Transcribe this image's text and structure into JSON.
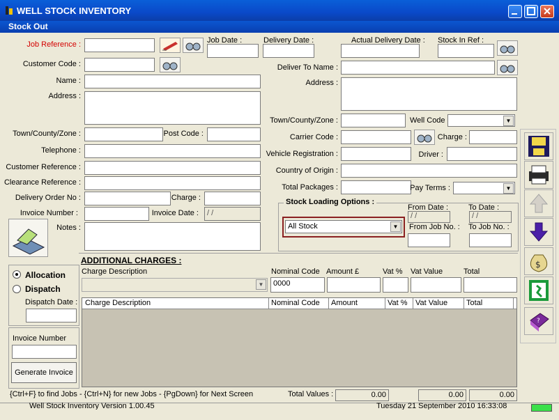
{
  "window": {
    "title": "WELL STOCK INVENTORY",
    "subtitle": "Stock Out"
  },
  "left": {
    "job_reference": "Job Reference :",
    "customer_code": "Customer Code :",
    "name": "Name :",
    "address": "Address :",
    "town": "Town/County/Zone :",
    "post_code": "Post Code :",
    "telephone": "Telephone :",
    "customer_reference": "Customer Reference :",
    "clearance_reference": "Clearance Reference :",
    "delivery_order_no": "Delivery Order No :",
    "charge": "Charge :",
    "invoice_number": "Invoice Number :",
    "invoice_date": "Invoice Date :",
    "invoice_date_value": "/ /",
    "notes": "Notes :"
  },
  "top": {
    "job_date": "Job Date :",
    "delivery_date": "Delivery Date :",
    "actual_delivery_date": "Actual Delivery Date :",
    "stock_in_ref": "Stock In Ref :"
  },
  "right": {
    "deliver_to_name": "Deliver To Name :",
    "address": "Address :",
    "town": "Town/County/Zone :",
    "well_code": "Well Code",
    "carrier_code": "Carrier Code :",
    "charge": "Charge :",
    "vehicle_registration": "Vehicle Registration :",
    "driver": "Driver :",
    "country_of_origin": "Country of Origin :",
    "total_packages": "Total Packages :",
    "pay_terms": "Pay Terms :"
  },
  "stock_loading": {
    "title": "Stock Loading Options :",
    "selected": "All Stock",
    "from_date": "From  Date :",
    "to_date": "To  Date :",
    "from_date_value": "/ /",
    "to_date_value": "/ /",
    "from_job_no": "From  Job No. :",
    "to_job_no": "To Job No. :"
  },
  "mode": {
    "allocation": "Allocation",
    "dispatch": "Dispatch",
    "dispatch_date": "Dispatch Date :",
    "invoice_number": "Invoice Number",
    "generate_invoice": "Generate Invoice"
  },
  "charges": {
    "title": "ADDITIONAL CHARGES :",
    "charge_description": "Charge Description",
    "nominal_code": "Nominal Code",
    "amount": "Amount £",
    "vat_pct": "Vat %",
    "vat_value": "Vat Value",
    "total": "Total",
    "nominal_value": "0000",
    "grid_headers": [
      "Charge Description",
      "Nominal Code",
      "Amount",
      "Vat %",
      "Vat Value",
      "Total"
    ]
  },
  "footer": {
    "hint": "{Ctrl+F} to find Jobs - {Ctrl+N} for new Jobs - {PgDown} for Next Screen",
    "total_values": "Total Values :",
    "total_1": "0.00",
    "total_2": "0.00",
    "total_3": "0.00",
    "version": "Well Stock Inventory  Version 1.00.45",
    "date": "Tuesday 21 September 2010  16:33:08"
  },
  "sidebar_icons": [
    "save-icon",
    "print-icon",
    "up-arrow-icon",
    "down-arrow-icon",
    "money-bag-icon",
    "exit-icon",
    "help-book-icon"
  ]
}
